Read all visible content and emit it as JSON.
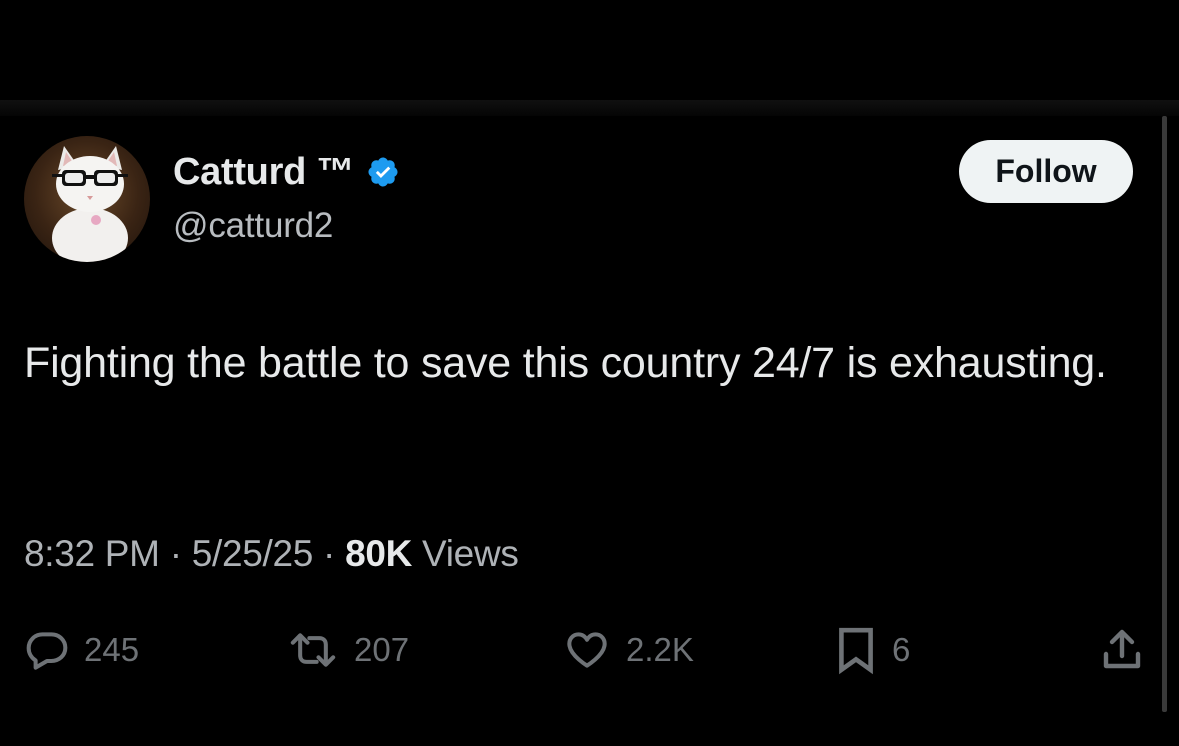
{
  "author": {
    "display_name": "Catturd ™",
    "handle": "@catturd2",
    "verified": true
  },
  "follow_button": {
    "label": "Follow"
  },
  "tweet": {
    "text": "Fighting the battle to save this country 24/7 is exhausting."
  },
  "meta": {
    "time": "8:32 PM",
    "separator": "·",
    "date": "5/25/25",
    "views_count": "80K",
    "views_label": "Views"
  },
  "actions": {
    "replies": "245",
    "reposts": "207",
    "likes": "2.2K",
    "bookmarks": "6"
  },
  "colors": {
    "background": "#000000",
    "text_primary": "#e7e9ea",
    "text_secondary": "#aeb2b6",
    "action_gray": "#6e7276",
    "verified_blue": "#1d9bf0",
    "follow_bg": "#eff3f4"
  },
  "icons": {
    "reply": "speech-bubble-icon",
    "repost": "repost-arrows-icon",
    "like": "heart-icon",
    "bookmark": "bookmark-icon",
    "share": "share-upload-icon",
    "verified": "verified-badge-icon"
  }
}
